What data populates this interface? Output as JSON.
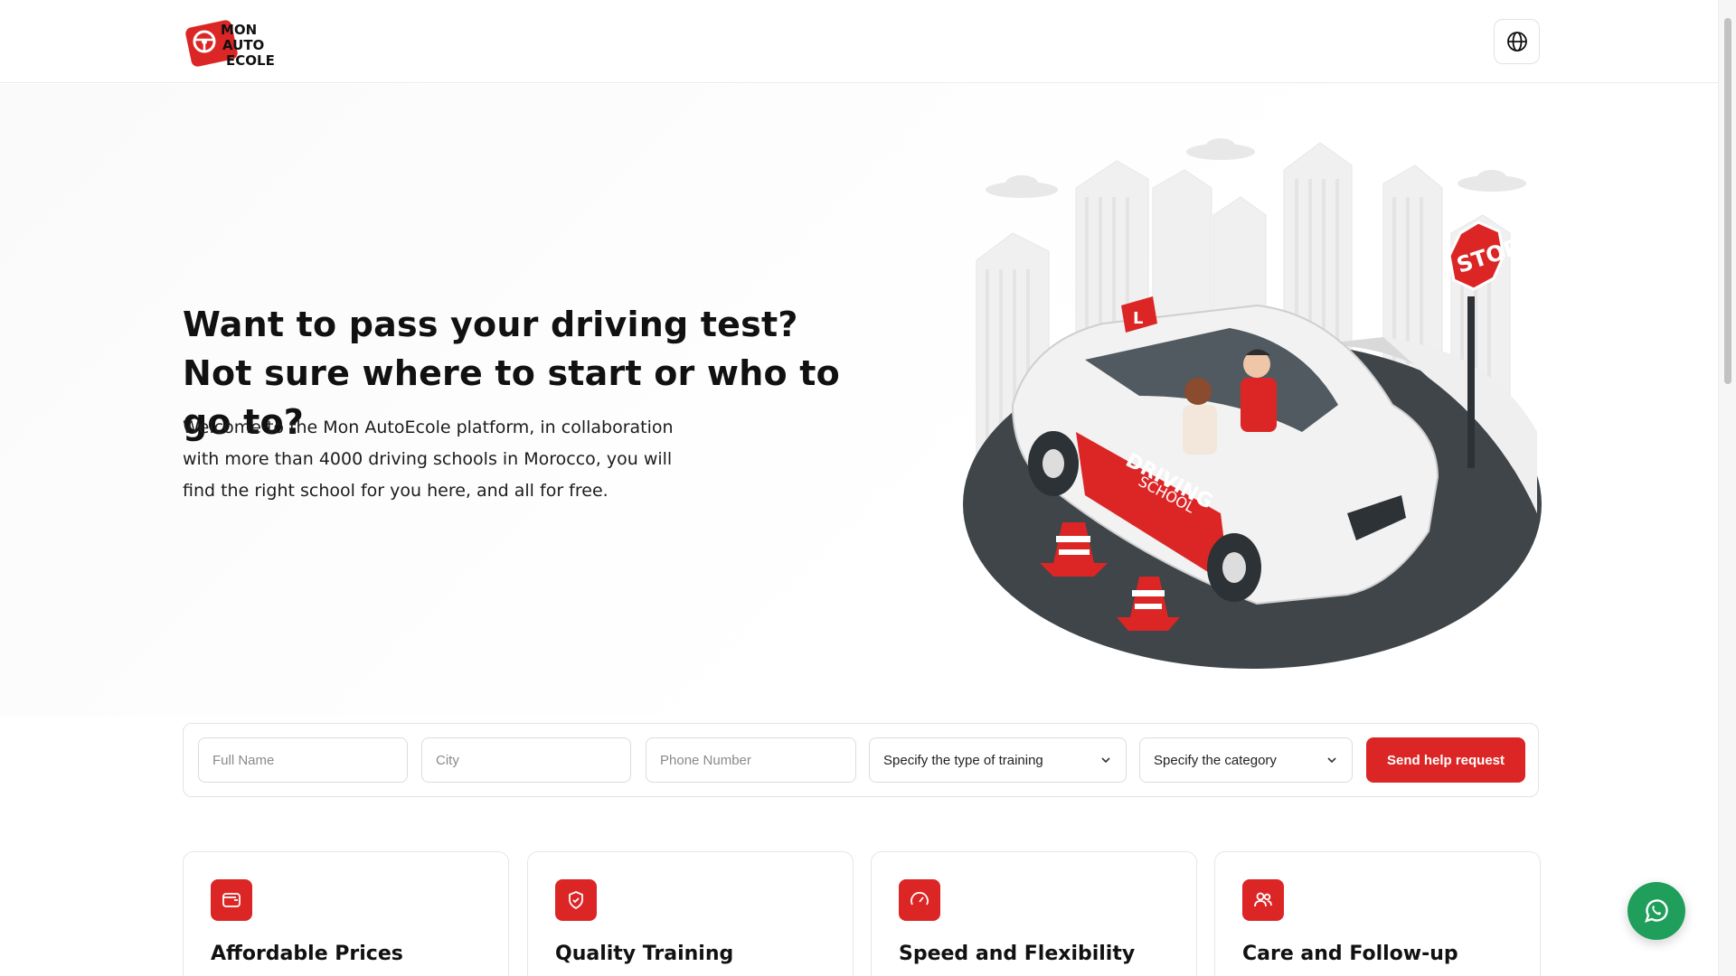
{
  "header": {
    "logo_lines": [
      "MON",
      "AUTO",
      "ECOLE"
    ],
    "language_icon": "globe-icon"
  },
  "hero": {
    "title": "Want to pass your driving test? Not sure where to start or who to go to?",
    "description": "Welcome to the Mon AutoEcole platform, in collaboration with more than 4000 driving schools in Morocco, you will find the right school for you here, and all for free.",
    "illustration": {
      "car_door_text": [
        "DRIVING",
        "SCHOOL"
      ],
      "sign_text": "STOP",
      "roof_sign_text": "L"
    }
  },
  "form": {
    "full_name_placeholder": "Full Name",
    "city_placeholder": "City",
    "phone_placeholder": "Phone Number",
    "training_type": "Specify the type of training",
    "category": "Specify the category",
    "submit_label": "Send help request"
  },
  "features": [
    {
      "title": "Affordable Prices",
      "icon": "wallet-icon"
    },
    {
      "title": "Quality Training",
      "icon": "shield-check-icon"
    },
    {
      "title": "Speed and Flexibility",
      "icon": "speedometer-icon"
    },
    {
      "title": "Care and Follow-up",
      "icon": "users-icon"
    }
  ],
  "floating": {
    "icon": "whatsapp-icon"
  },
  "colors": {
    "accent": "#dc2626",
    "whatsapp": "#1f9f5b",
    "asphalt": "#3f4549"
  }
}
